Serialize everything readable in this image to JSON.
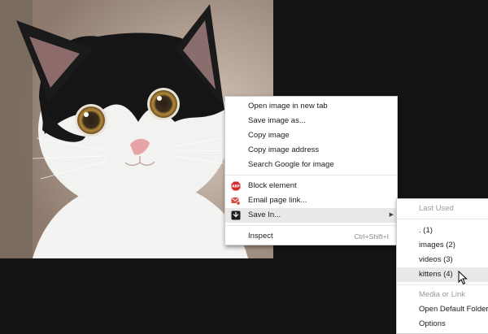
{
  "context_menu": {
    "items": [
      {
        "label": "Open image in new tab"
      },
      {
        "label": "Save image as..."
      },
      {
        "label": "Copy image"
      },
      {
        "label": "Copy image address"
      },
      {
        "label": "Search Google for image"
      },
      {
        "label": "Block element",
        "icon": "adblock-icon"
      },
      {
        "label": "Email page link...",
        "icon": "email-icon"
      },
      {
        "label": "Save In...",
        "icon": "save-in-icon"
      },
      {
        "label": "Inspect",
        "shortcut": "Ctrl+Shift+I"
      }
    ]
  },
  "submenu": {
    "header": "Last Used",
    "folders": [
      ". (1)",
      "images (2)",
      "videos (3)",
      "kittens (4)"
    ],
    "section2": "Media or Link",
    "actions": [
      "Open Default Folder",
      "Options"
    ]
  },
  "colors": {
    "background": "#141414",
    "menu": "#ffffff",
    "highlight": "#e8e8e8",
    "adblock_red": "#d42a2a",
    "email_red": "#d74a3f"
  }
}
